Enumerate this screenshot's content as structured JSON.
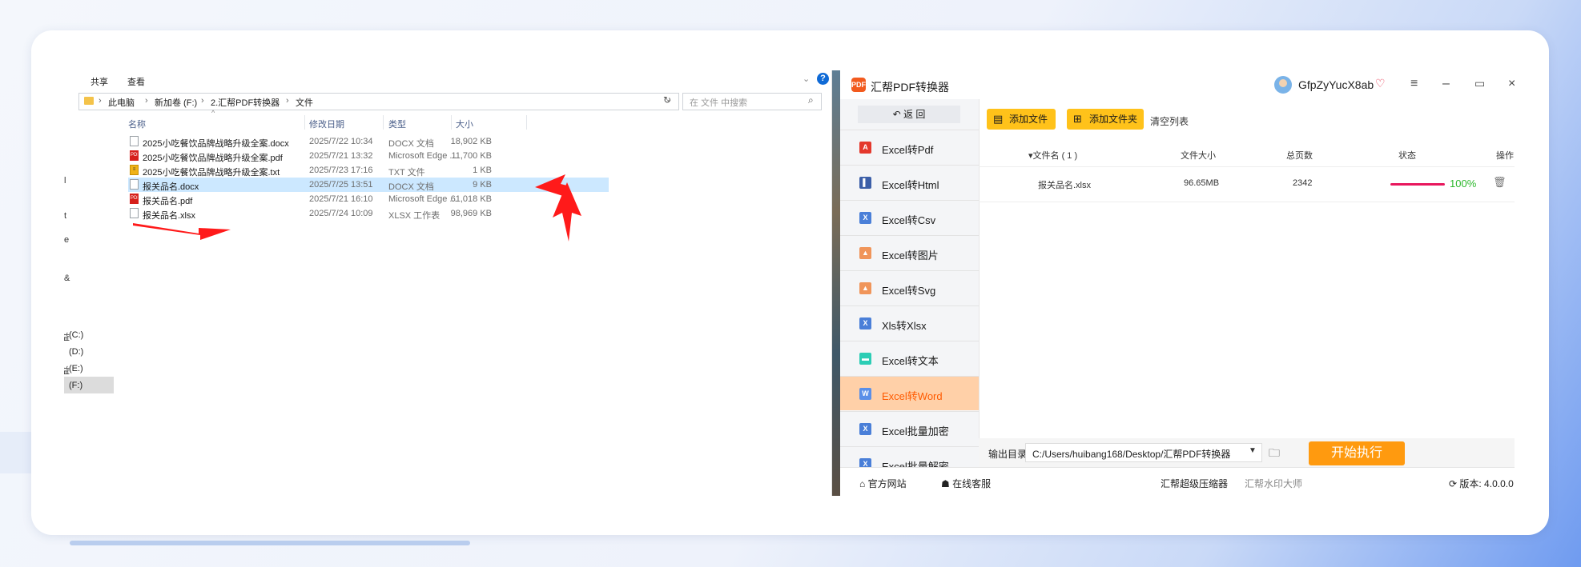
{
  "explorer": {
    "menu": {
      "share": "共享",
      "view": "查看"
    },
    "left_edge_letters": [
      "l",
      "t",
      "e",
      "&"
    ],
    "address": {
      "segments": [
        "此电脑",
        "新加卷 (F:)",
        "2.汇帮PDF转换器",
        "文件"
      ],
      "sep": "›"
    },
    "search_placeholder": "在 文件 中搜索",
    "columns": {
      "name": "名称",
      "date": "修改日期",
      "type": "类型",
      "size": "大小"
    },
    "files": [
      {
        "name": "2025小吃餐饮品牌战略升级全案.docx",
        "date": "2025/7/22 10:34",
        "type": "DOCX 文档",
        "size": "18,902 KB",
        "kind": "doc"
      },
      {
        "name": "2025小吃餐饮品牌战略升级全案.pdf",
        "date": "2025/7/21 13:32",
        "type": "Microsoft Edge ...",
        "size": "11,700 KB",
        "kind": "pdf"
      },
      {
        "name": "2025小吃餐饮品牌战略升级全案.txt",
        "date": "2025/7/23 17:16",
        "type": "TXT 文件",
        "size": "1 KB",
        "kind": "txt"
      },
      {
        "name": "报关品名.docx",
        "date": "2025/7/25 13:51",
        "type": "DOCX 文档",
        "size": "9 KB",
        "kind": "doc"
      },
      {
        "name": "报关品名.pdf",
        "date": "2025/7/21 16:10",
        "type": "Microsoft Edge ...",
        "size": "61,018 KB",
        "kind": "pdf"
      },
      {
        "name": "报关品名.xlsx",
        "date": "2025/7/24 10:09",
        "type": "XLSX 工作表",
        "size": "98,969 KB",
        "kind": "doc"
      }
    ],
    "selected_row": 3,
    "drives": [
      {
        "label": "(C:)",
        "edge": "益"
      },
      {
        "label": "(D:)",
        "edge": ""
      },
      {
        "label": "(E:)",
        "edge": "益"
      },
      {
        "label": "(F:)",
        "edge": ""
      }
    ]
  },
  "app": {
    "title": "汇帮PDF转换器",
    "logo_text": "PDF",
    "username": "GfpZyYucX8ab",
    "back_label": "返  回",
    "nav": [
      {
        "label": "Excel转Pdf",
        "icon": "pdf-icon",
        "color": "#e4382c",
        "glyph": "A"
      },
      {
        "label": "Excel转Html",
        "icon": "html-icon",
        "color": "#3c5fa8",
        "glyph": "▌"
      },
      {
        "label": "Excel转Csv",
        "icon": "csv-icon",
        "color": "#4a7fd8",
        "glyph": "X"
      },
      {
        "label": "Excel转图片",
        "icon": "image-icon",
        "color": "#f0955a",
        "glyph": "▲"
      },
      {
        "label": "Excel转Svg",
        "icon": "svg-icon",
        "color": "#f0955a",
        "glyph": "▲"
      },
      {
        "label": "Xls转Xlsx",
        "icon": "xlsx-icon",
        "color": "#4a7fd8",
        "glyph": "X"
      },
      {
        "label": "Excel转文本",
        "icon": "text-icon",
        "color": "#2ccdb5",
        "glyph": "▬"
      },
      {
        "label": "Excel转Word",
        "icon": "word-icon",
        "color": "#5a8fe8",
        "glyph": "W"
      },
      {
        "label": "Excel批量加密",
        "icon": "encrypt-icon",
        "color": "#4a7fd8",
        "glyph": "X"
      },
      {
        "label": "Excel批量解密",
        "icon": "decrypt-icon",
        "color": "#4a7fd8",
        "glyph": "X"
      }
    ],
    "active_nav": 7,
    "toolbar": {
      "add_file": "添加文件",
      "add_folder": "添加文件夹",
      "clear": "清空列表"
    },
    "table_headers": {
      "filename": "▾文件名 ( 1 )",
      "size": "文件大小",
      "pages": "总页数",
      "status": "状态",
      "action": "操作"
    },
    "row": {
      "filename": "报关品名.xlsx",
      "size": "96.65MB",
      "pages": "2342",
      "progress_pct": 100,
      "pct_label": "100%"
    },
    "output": {
      "label": "输出目录:",
      "path": "C:/Users/huibang168/Desktop/汇帮PDF转换器"
    },
    "start_label": "开始执行",
    "statusbar": {
      "website": "官方网站",
      "service": "在线客服",
      "compressor": "汇帮超级压缩器",
      "watermark": "汇帮水印大师",
      "version": "版本: 4.0.0.0"
    }
  }
}
